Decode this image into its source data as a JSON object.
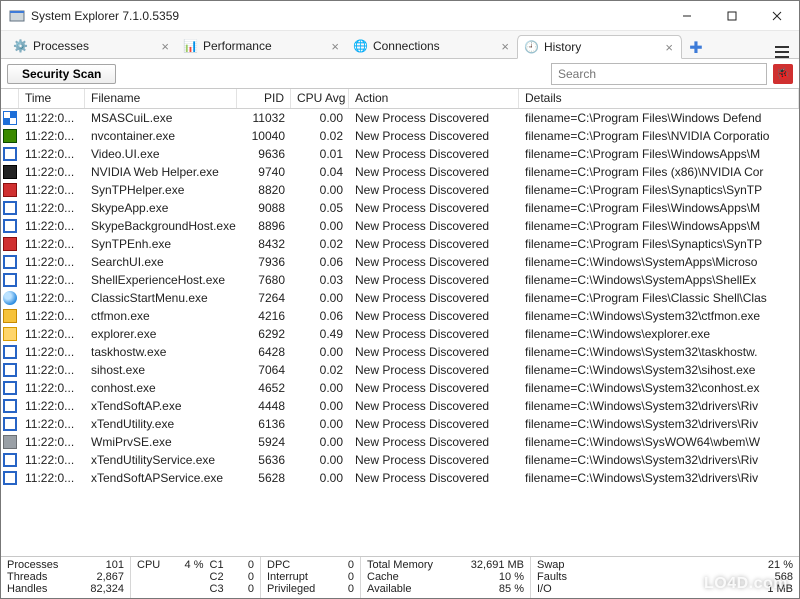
{
  "window": {
    "title": "System Explorer 7.1.0.5359"
  },
  "tabs": [
    {
      "label": "Processes",
      "icon": "gear-icon"
    },
    {
      "label": "Performance",
      "icon": "perf-icon"
    },
    {
      "label": "Connections",
      "icon": "globe-icon"
    },
    {
      "label": "History",
      "icon": "clock-icon",
      "active": true
    }
  ],
  "toolbar": {
    "security_scan": "Security Scan"
  },
  "search": {
    "placeholder": "Search"
  },
  "columns": {
    "time": "Time",
    "filename": "Filename",
    "pid": "PID",
    "cpuavg": "CPU Avg",
    "action": "Action",
    "details": "Details"
  },
  "rows": [
    {
      "icon": "shield",
      "time": "11:22:0...",
      "file": "MSASCuiL.exe",
      "pid": "11032",
      "cpu": "0.00",
      "action": "New Process Discovered",
      "details": "filename=C:\\Program Files\\Windows Defend"
    },
    {
      "icon": "nv",
      "time": "11:22:0...",
      "file": "nvcontainer.exe",
      "pid": "10040",
      "cpu": "0.02",
      "action": "New Process Discovered",
      "details": "filename=C:\\Program Files\\NVIDIA Corporatio"
    },
    {
      "icon": "blank",
      "time": "11:22:0...",
      "file": "Video.UI.exe",
      "pid": "9636",
      "cpu": "0.01",
      "action": "New Process Discovered",
      "details": "filename=C:\\Program Files\\WindowsApps\\M"
    },
    {
      "icon": "dk",
      "time": "11:22:0...",
      "file": "NVIDIA Web Helper.exe",
      "pid": "9740",
      "cpu": "0.04",
      "action": "New Process Discovered",
      "details": "filename=C:\\Program Files (x86)\\NVIDIA Cor"
    },
    {
      "icon": "red",
      "time": "11:22:0...",
      "file": "SynTPHelper.exe",
      "pid": "8820",
      "cpu": "0.00",
      "action": "New Process Discovered",
      "details": "filename=C:\\Program Files\\Synaptics\\SynTP"
    },
    {
      "icon": "blank",
      "time": "11:22:0...",
      "file": "SkypeApp.exe",
      "pid": "9088",
      "cpu": "0.05",
      "action": "New Process Discovered",
      "details": "filename=C:\\Program Files\\WindowsApps\\M"
    },
    {
      "icon": "blank",
      "time": "11:22:0...",
      "file": "SkypeBackgroundHost.exe",
      "pid": "8896",
      "cpu": "0.00",
      "action": "New Process Discovered",
      "details": "filename=C:\\Program Files\\WindowsApps\\M"
    },
    {
      "icon": "red",
      "time": "11:22:0...",
      "file": "SynTPEnh.exe",
      "pid": "8432",
      "cpu": "0.02",
      "action": "New Process Discovered",
      "details": "filename=C:\\Program Files\\Synaptics\\SynTP"
    },
    {
      "icon": "blank",
      "time": "11:22:0...",
      "file": "SearchUI.exe",
      "pid": "7936",
      "cpu": "0.06",
      "action": "New Process Discovered",
      "details": "filename=C:\\Windows\\SystemApps\\Microso"
    },
    {
      "icon": "blank",
      "time": "11:22:0...",
      "file": "ShellExperienceHost.exe",
      "pid": "7680",
      "cpu": "0.03",
      "action": "New Process Discovered",
      "details": "filename=C:\\Windows\\SystemApps\\ShellEx"
    },
    {
      "icon": "globe",
      "time": "11:22:0...",
      "file": "ClassicStartMenu.exe",
      "pid": "7264",
      "cpu": "0.00",
      "action": "New Process Discovered",
      "details": "filename=C:\\Program Files\\Classic Shell\\Clas"
    },
    {
      "icon": "key",
      "time": "11:22:0...",
      "file": "ctfmon.exe",
      "pid": "4216",
      "cpu": "0.06",
      "action": "New Process Discovered",
      "details": "filename=C:\\Windows\\System32\\ctfmon.exe"
    },
    {
      "icon": "folder",
      "time": "11:22:0...",
      "file": "explorer.exe",
      "pid": "6292",
      "cpu": "0.49",
      "action": "New Process Discovered",
      "details": "filename=C:\\Windows\\explorer.exe"
    },
    {
      "icon": "blank",
      "time": "11:22:0...",
      "file": "taskhostw.exe",
      "pid": "6428",
      "cpu": "0.00",
      "action": "New Process Discovered",
      "details": "filename=C:\\Windows\\System32\\taskhostw."
    },
    {
      "icon": "blank",
      "time": "11:22:0...",
      "file": "sihost.exe",
      "pid": "7064",
      "cpu": "0.02",
      "action": "New Process Discovered",
      "details": "filename=C:\\Windows\\System32\\sihost.exe"
    },
    {
      "icon": "blank",
      "time": "11:22:0...",
      "file": "conhost.exe",
      "pid": "4652",
      "cpu": "0.00",
      "action": "New Process Discovered",
      "details": "filename=C:\\Windows\\System32\\conhost.ex"
    },
    {
      "icon": "blank",
      "time": "11:22:0...",
      "file": "xTendSoftAP.exe",
      "pid": "4448",
      "cpu": "0.00",
      "action": "New Process Discovered",
      "details": "filename=C:\\Windows\\System32\\drivers\\Riv"
    },
    {
      "icon": "blank",
      "time": "11:22:0...",
      "file": "xTendUtility.exe",
      "pid": "6136",
      "cpu": "0.00",
      "action": "New Process Discovered",
      "details": "filename=C:\\Windows\\System32\\drivers\\Riv"
    },
    {
      "icon": "mach",
      "time": "11:22:0...",
      "file": "WmiPrvSE.exe",
      "pid": "5924",
      "cpu": "0.00",
      "action": "New Process Discovered",
      "details": "filename=C:\\Windows\\SysWOW64\\wbem\\W"
    },
    {
      "icon": "blank",
      "time": "11:22:0...",
      "file": "xTendUtilityService.exe",
      "pid": "5636",
      "cpu": "0.00",
      "action": "New Process Discovered",
      "details": "filename=C:\\Windows\\System32\\drivers\\Riv"
    },
    {
      "icon": "blank",
      "time": "11:22:0...",
      "file": "xTendSoftAPService.exe",
      "pid": "5628",
      "cpu": "0.00",
      "action": "New Process Discovered",
      "details": "filename=C:\\Windows\\System32\\drivers\\Riv"
    }
  ],
  "status": {
    "g1": {
      "Processes": "101",
      "Threads": "2,867",
      "Handles": "82,324"
    },
    "g2": {
      "CPU": "4 %",
      "C1": "0",
      "C2": "0",
      "C3": "0"
    },
    "g3": {
      "DPC": "0",
      "Interrupt": "0",
      "Privileged": "0"
    },
    "g4": {
      "Total Memory": "32,691 MB",
      "Cache": "10 %",
      "Available": "85 %"
    },
    "g5": {
      "Swap": "21 %",
      "Faults": "568",
      "I/O": "1 MB"
    }
  },
  "watermark": "LO4D.com"
}
